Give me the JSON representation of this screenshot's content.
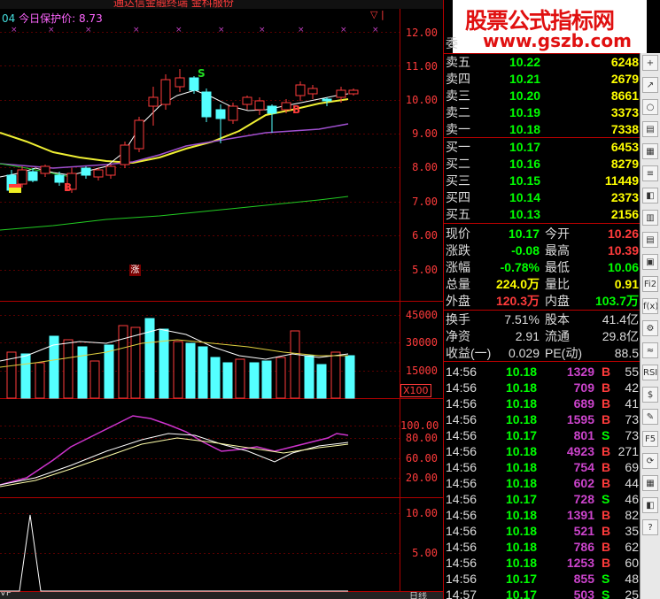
{
  "top_title": "通达信金融终端   金科服份",
  "price_indicator": {
    "prefix": "04",
    "label": "今日保护价:",
    "value": "8.73"
  },
  "price_axis": [
    "12.00",
    "11.00",
    "10.00",
    "9.00",
    "8.00",
    "7.00",
    "6.00",
    "5.00"
  ],
  "volume_axis": [
    "45000",
    "30000",
    "15000"
  ],
  "volume_unit": "X100",
  "macd_axis": [
    "100.00",
    "80.00",
    "60.00",
    "20.00"
  ],
  "bottom_axis": [
    "10.00",
    "5.00"
  ],
  "signals": {
    "sell": "S",
    "buy": "B"
  },
  "zhang_label": "涨",
  "watermark": {
    "line1": "股票公式指标网",
    "line2": "www.gszb.com"
  },
  "weibi_label": "委",
  "sell_orders": [
    {
      "label": "卖五",
      "price": "10.22",
      "vol": "6248"
    },
    {
      "label": "卖四",
      "price": "10.21",
      "vol": "2679"
    },
    {
      "label": "卖三",
      "price": "10.20",
      "vol": "8661"
    },
    {
      "label": "卖二",
      "price": "10.19",
      "vol": "3373"
    },
    {
      "label": "卖一",
      "price": "10.18",
      "vol": "7338"
    }
  ],
  "buy_orders": [
    {
      "label": "买一",
      "price": "10.17",
      "vol": "6453"
    },
    {
      "label": "买二",
      "price": "10.16",
      "vol": "8279"
    },
    {
      "label": "买三",
      "price": "10.15",
      "vol": "11449"
    },
    {
      "label": "买四",
      "price": "10.14",
      "vol": "2373"
    },
    {
      "label": "买五",
      "price": "10.13",
      "vol": "2156"
    }
  ],
  "quote": [
    {
      "l1": "现价",
      "v1": "10.17",
      "l2": "今开",
      "v2": "10.26",
      "c1": "#00ff00",
      "c2": "#ff3b3b"
    },
    {
      "l1": "涨跌",
      "v1": "-0.08",
      "l2": "最高",
      "v2": "10.39",
      "c1": "#00ff00",
      "c2": "#ff3b3b"
    },
    {
      "l1": "涨幅",
      "v1": "-0.78%",
      "l2": "最低",
      "v2": "10.06",
      "c1": "#00ff00",
      "c2": "#00ff00"
    },
    {
      "l1": "总量",
      "v1": "224.0万",
      "l2": "量比",
      "v2": "0.91",
      "c1": "#ffff00",
      "c2": "#ffff00"
    },
    {
      "l1": "外盘",
      "v1": "120.3万",
      "l2": "内盘",
      "v2": "103.7万",
      "c1": "#ff3b3b",
      "c2": "#00ff00"
    }
  ],
  "fundamentals": [
    {
      "l1": "换手",
      "v1": "7.51%",
      "l2": "股本",
      "v2": "41.4亿"
    },
    {
      "l1": "净资",
      "v1": "2.91",
      "l2": "流通",
      "v2": "29.8亿"
    },
    {
      "l1": "收益(一)",
      "v1": "0.029",
      "l2": "PE(动)",
      "v2": "88.5"
    }
  ],
  "ticks": [
    {
      "time": "14:56",
      "price": "10.18",
      "vol": "1329",
      "dir": "B",
      "n": "55"
    },
    {
      "time": "14:56",
      "price": "10.18",
      "vol": "709",
      "dir": "B",
      "n": "42"
    },
    {
      "time": "14:56",
      "price": "10.18",
      "vol": "689",
      "dir": "B",
      "n": "41"
    },
    {
      "time": "14:56",
      "price": "10.18",
      "vol": "1595",
      "dir": "B",
      "n": "73"
    },
    {
      "time": "14:56",
      "price": "10.17",
      "vol": "801",
      "dir": "S",
      "n": "73"
    },
    {
      "time": "14:56",
      "price": "10.18",
      "vol": "4923",
      "dir": "B",
      "n": "271"
    },
    {
      "time": "14:56",
      "price": "10.18",
      "vol": "754",
      "dir": "B",
      "n": "69"
    },
    {
      "time": "14:56",
      "price": "10.18",
      "vol": "602",
      "dir": "B",
      "n": "44"
    },
    {
      "time": "14:56",
      "price": "10.17",
      "vol": "728",
      "dir": "S",
      "n": "46"
    },
    {
      "time": "14:56",
      "price": "10.18",
      "vol": "1391",
      "dir": "B",
      "n": "82"
    },
    {
      "time": "14:56",
      "price": "10.18",
      "vol": "521",
      "dir": "B",
      "n": "35"
    },
    {
      "time": "14:56",
      "price": "10.18",
      "vol": "786",
      "dir": "B",
      "n": "62"
    },
    {
      "time": "14:56",
      "price": "10.18",
      "vol": "1253",
      "dir": "B",
      "n": "60"
    },
    {
      "time": "14:56",
      "price": "10.17",
      "vol": "855",
      "dir": "S",
      "n": "48"
    },
    {
      "time": "14:57",
      "price": "10.17",
      "vol": "503",
      "dir": "S",
      "n": "25"
    }
  ],
  "toolbar": [
    "+",
    "↗",
    "○",
    "▤",
    "▦",
    "≡",
    "◧",
    "▥",
    "▤",
    "▣",
    "Fi2",
    "f(x)",
    "⚙",
    "≈",
    "RSI",
    "$",
    "✎",
    "F5",
    "⟳",
    "▦",
    "◧",
    "?"
  ],
  "bottom_labels": [
    "VP",
    "日线"
  ],
  "colors": {
    "up": "#ff3b3b",
    "down": "#54ffff",
    "price": "#00ff00"
  }
}
